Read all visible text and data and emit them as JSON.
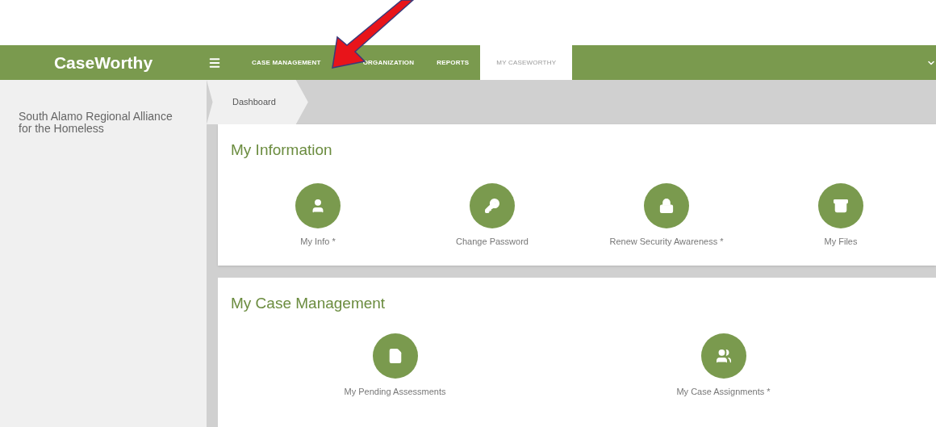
{
  "header": {
    "logo": "CaseWorthy",
    "nav": [
      {
        "label": "CASE MANAGEMENT",
        "selected": false
      },
      {
        "label": "ORGANIZATION",
        "selected": false
      },
      {
        "label": "REPORTS",
        "selected": false
      },
      {
        "label": "MY CASEWORTHY",
        "selected": true
      }
    ]
  },
  "sidebar": {
    "organization": "South Alamo Regional Alliance for the Homeless"
  },
  "breadcrumb": [
    "Dashboard"
  ],
  "sections": [
    {
      "title": "My Information",
      "items": [
        {
          "label": "My Info *",
          "kind": "user"
        },
        {
          "label": "Change Password",
          "kind": "key"
        },
        {
          "label": "Renew Security Awareness *",
          "kind": "lock"
        },
        {
          "label": "My Files",
          "kind": "archive"
        }
      ]
    },
    {
      "title": "My Case Management",
      "items": [
        {
          "label": "My Pending Assessments",
          "kind": "file"
        },
        {
          "label": "My Case Assignments *",
          "kind": "users"
        }
      ]
    }
  ]
}
